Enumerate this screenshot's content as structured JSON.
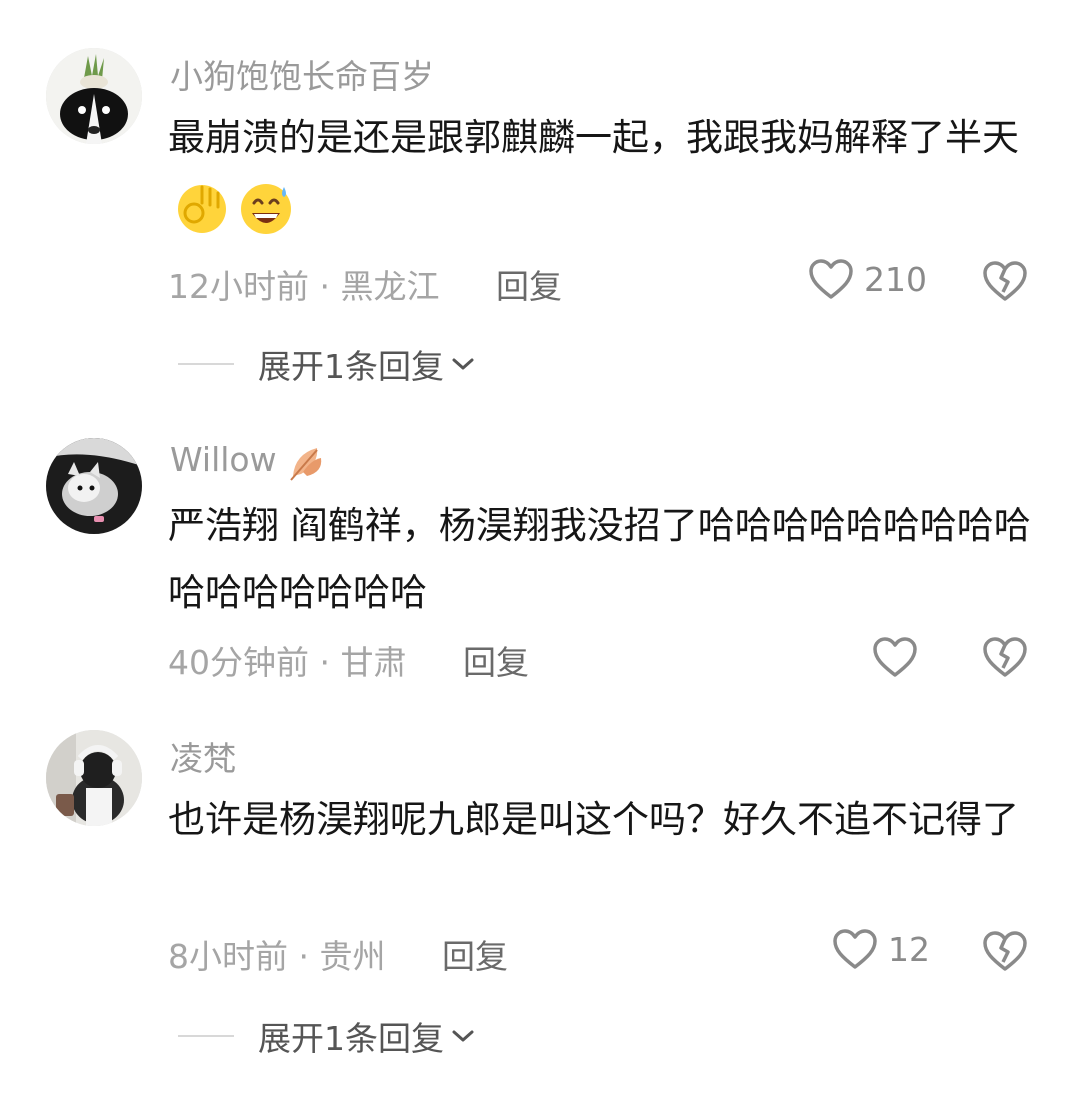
{
  "comments": [
    {
      "username": "小狗饱饱长命百岁",
      "text": "最崩溃的是还是跟郭麒麟一起，我跟我妈解释了半天",
      "emojis": [
        "ok-hand-emoji",
        "grinning-sweat-emoji"
      ],
      "time": "12小时前",
      "location": "黑龙江",
      "reply_label": "回复",
      "likes": "210",
      "expand_label": "展开1条回复"
    },
    {
      "username": "Willow",
      "username_icon": "autumn-leaf-icon",
      "text": "严浩翔 阎鹤祥，杨淏翔我没招了哈哈哈哈哈哈哈哈哈哈哈哈哈哈哈哈",
      "time": "40分钟前",
      "location": "甘肃",
      "reply_label": "回复",
      "likes": ""
    },
    {
      "username": "凌梵",
      "text": "也许是杨淏翔呢九郎是叫这个吗？好久不追不记得了",
      "time": "8小时前",
      "location": "贵州",
      "reply_label": "回复",
      "likes": "12",
      "expand_label": "展开1条回复"
    }
  ],
  "meta_separator": "·",
  "colors": {
    "secondary_text": "#a5a5a5",
    "icon": "#8a8a8a",
    "emoji_yellow": "#ffd43b"
  }
}
